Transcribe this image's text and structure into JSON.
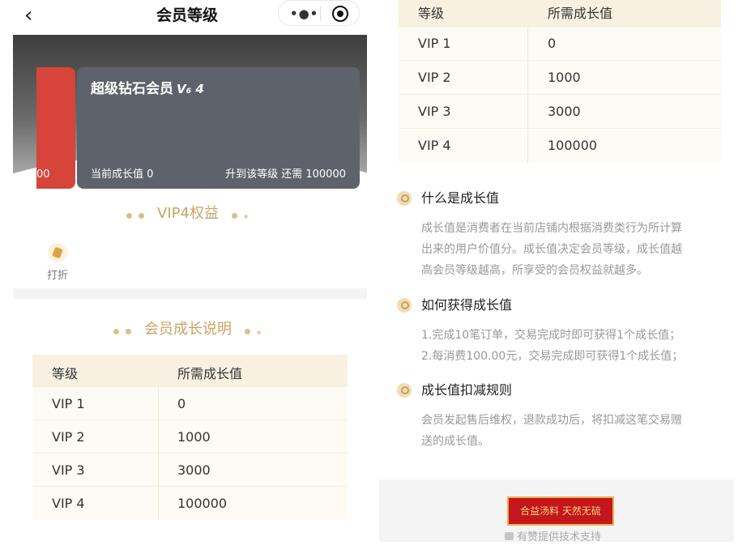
{
  "nav": {
    "back_glyph": "‹",
    "title": "会员等级",
    "more_glyph": "•●•"
  },
  "cards": {
    "prev_value_partial": "00",
    "current": {
      "name": "超级钻石会员",
      "badge": "V₆ 4",
      "current_label": "当前成长值 0",
      "need_label": "升到该等级 还需 100000"
    }
  },
  "benefits": {
    "title": "VIP4权益",
    "items": [
      {
        "label": "打折",
        "icon": "tag-icon"
      }
    ]
  },
  "growth": {
    "title": "会员成长说明"
  },
  "table": {
    "headers": [
      "等级",
      "所需成长值"
    ],
    "rows": [
      [
        "VIP 1",
        "0"
      ],
      [
        "VIP 2",
        "1000"
      ],
      [
        "VIP 3",
        "3000"
      ],
      [
        "VIP 4",
        "100000"
      ]
    ]
  },
  "faq": [
    {
      "q": "什么是成长值",
      "a": [
        "成长值是消费者在当前店铺内根据消费类行为所计算",
        "出来的用户价值分。成长值决定会员等级，成长值越",
        "高会员等级越高，所享受的会员权益就越多。"
      ]
    },
    {
      "q": "如何获得成长值",
      "a": [
        "1.完成10笔订单，交易完成时即可获得1个成长值；",
        "2.每消费100.00元，交易完成即可获得1个成长值；"
      ]
    },
    {
      "q": "成长值扣减规则",
      "a": [
        "会员发起售后维权，退款成功后，将扣减这笔交易赠",
        "送的成长值。"
      ]
    }
  ],
  "footer": {
    "logo_text": "合益汤料  天然无硫",
    "support": "有赞提供技术支持"
  },
  "colors": {
    "accent": "#c8a564",
    "card_bg": "#5e636b",
    "red_card": "#d7443a"
  }
}
